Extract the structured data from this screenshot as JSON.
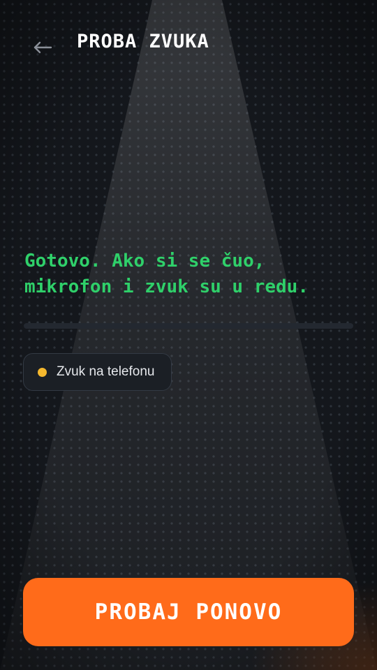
{
  "header": {
    "back_icon": "arrow-left-icon",
    "title": "PROBA ZVUKA"
  },
  "message": {
    "line1": "Gotovo. Ako si se čuo,",
    "line2": "mikrofon i zvuk su u redu."
  },
  "audio_output": {
    "label": "Zvuk na telefonu",
    "status_icon": "status-dot-icon"
  },
  "actions": {
    "retry_label": "PROBAJ PONOVO"
  },
  "colors": {
    "background": "#14171c",
    "message_text": "#2fd06a",
    "accent_button": "#ff6b1a",
    "status_dot": "#f5b82e",
    "back_icon": "#8a8f98"
  }
}
